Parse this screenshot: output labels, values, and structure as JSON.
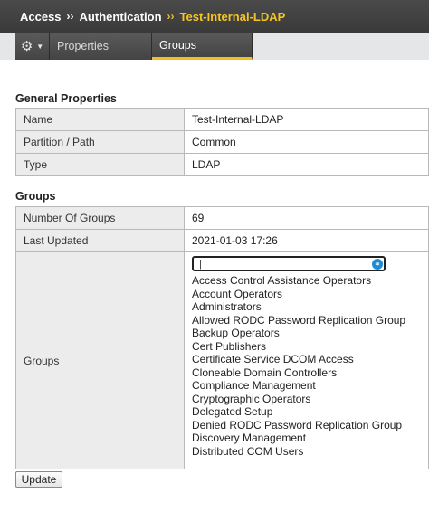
{
  "breadcrumb": {
    "items": [
      "Access",
      "Authentication",
      "Test-Internal-LDAP"
    ],
    "separator": "››"
  },
  "tabs": [
    {
      "label": "Properties",
      "active": false
    },
    {
      "label": "Groups",
      "active": true
    }
  ],
  "general": {
    "title": "General Properties",
    "rows": [
      {
        "label": "Name",
        "value": "Test-Internal-LDAP"
      },
      {
        "label": "Partition / Path",
        "value": "Common"
      },
      {
        "label": "Type",
        "value": "LDAP"
      }
    ]
  },
  "groups_section": {
    "title": "Groups",
    "rows": [
      {
        "label": "Number Of Groups",
        "value": "69"
      },
      {
        "label": "Last Updated",
        "value": "2021-01-03 17:26"
      }
    ],
    "groups_label": "Groups",
    "search": {
      "value": "",
      "placeholder": ""
    },
    "list": [
      "Access Control Assistance Operators",
      "Account Operators",
      "Administrators",
      "Allowed RODC Password Replication Group",
      "Backup Operators",
      "Cert Publishers",
      "Certificate Service DCOM Access",
      "Cloneable Domain Controllers",
      "Compliance Management",
      "Cryptographic Operators",
      "Delegated Setup",
      "Denied RODC Password Replication Group",
      "Discovery Management",
      "Distributed COM Users"
    ]
  },
  "actions": {
    "update_label": "Update"
  },
  "colors": {
    "accent": "#f0c020",
    "header_bg": "#404040",
    "label_bg": "#ececec"
  }
}
